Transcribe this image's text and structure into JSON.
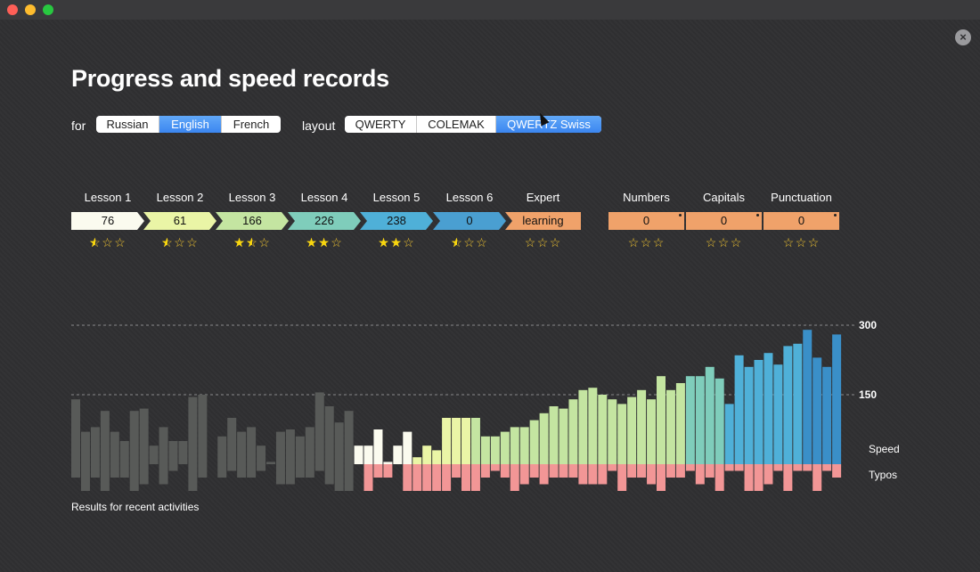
{
  "window": {
    "close_glyph": "×"
  },
  "title": "Progress and speed records",
  "for_label": "for",
  "layout_label": "layout",
  "languages": {
    "options": [
      "Russian",
      "English",
      "French"
    ],
    "selected": "English"
  },
  "layouts": {
    "options": [
      "QWERTY",
      "COLEMAK",
      "QWERTZ Swiss"
    ],
    "selected": "QWERTZ Swiss"
  },
  "lessons": [
    {
      "name": "Lesson 1",
      "value": "76",
      "color": "#fbfbef",
      "stars": 0.5
    },
    {
      "name": "Lesson 2",
      "value": "61",
      "color": "#eaf5a6",
      "stars": 0.5
    },
    {
      "name": "Lesson 3",
      "value": "166",
      "color": "#c4e5a1",
      "stars": 1.5
    },
    {
      "name": "Lesson 4",
      "value": "226",
      "color": "#7fcdbb",
      "stars": 2
    },
    {
      "name": "Lesson 5",
      "value": "238",
      "color": "#4fb0d8",
      "stars": 2
    },
    {
      "name": "Lesson 6",
      "value": "0",
      "color": "#4a9fd1",
      "stars": 0.5
    },
    {
      "name": "Expert",
      "value": "learning",
      "color": "#f0a26a",
      "stars": 0
    }
  ],
  "extras": [
    {
      "name": "Numbers",
      "value": "0",
      "color": "#f0a26a",
      "stars": 0
    },
    {
      "name": "Capitals",
      "value": "0",
      "color": "#f0a26a",
      "stars": 0
    },
    {
      "name": "Punctuation",
      "value": "0",
      "color": "#f0a26a",
      "stars": 0
    }
  ],
  "chart_data": {
    "type": "bar",
    "x": [
      1,
      2,
      3,
      4,
      5,
      6,
      7,
      8,
      9,
      10,
      11,
      12,
      13,
      14,
      15,
      16,
      17,
      18,
      19,
      20,
      21,
      22,
      23,
      24,
      25,
      26,
      27,
      28,
      29,
      30,
      31,
      32,
      33,
      34,
      35,
      36,
      37,
      38,
      39,
      40,
      41,
      42,
      43,
      44,
      45,
      46,
      47,
      48,
      49,
      50,
      51,
      52,
      53,
      54,
      55,
      56,
      57,
      58,
      59,
      60,
      61,
      62,
      63,
      64,
      65,
      66,
      67,
      68,
      69,
      70,
      71,
      72,
      73,
      74,
      75,
      76,
      77,
      78,
      79
    ],
    "series": [
      {
        "name": "Speed",
        "values": [
          140,
          70,
          80,
          115,
          70,
          50,
          115,
          120,
          40,
          80,
          50,
          50,
          145,
          150,
          0,
          60,
          100,
          70,
          80,
          40,
          5,
          70,
          75,
          60,
          80,
          155,
          125,
          90,
          115,
          40,
          40,
          75,
          5,
          40,
          70,
          15,
          40,
          30,
          100,
          100,
          100,
          100,
          60,
          60,
          70,
          80,
          80,
          95,
          110,
          125,
          120,
          140,
          160,
          165,
          150,
          140,
          130,
          145,
          160,
          140,
          190,
          160,
          175,
          190,
          190,
          210,
          185,
          130,
          235,
          210,
          225,
          240,
          215,
          255,
          260,
          290,
          230,
          210,
          280,
          265,
          270,
          270,
          280,
          275,
          240,
          265
        ],
        "colors": [
          "#585a58",
          "#585a58",
          "#585a58",
          "#585a58",
          "#585a58",
          "#585a58",
          "#585a58",
          "#585a58",
          "#585a58",
          "#585a58",
          "#585a58",
          "#585a58",
          "#585a58",
          "#585a58",
          "#585a58",
          "#585a58",
          "#585a58",
          "#585a58",
          "#585a58",
          "#585a58",
          "#585a58",
          "#585a58",
          "#585a58",
          "#585a58",
          "#585a58",
          "#585a58",
          "#585a58",
          "#585a58",
          "#585a58",
          "#fbfbef",
          "#fbfbef",
          "#fbfbef",
          "#fbfbef",
          "#fbfbef",
          "#fbfbef",
          "#eaf5a6",
          "#eaf5a6",
          "#eaf5a6",
          "#eaf5a6",
          "#eaf5a6",
          "#eaf5a6",
          "#c4e5a1",
          "#c4e5a1",
          "#c4e5a1",
          "#c4e5a1",
          "#c4e5a1",
          "#c4e5a1",
          "#c4e5a1",
          "#c4e5a1",
          "#c4e5a1",
          "#c4e5a1",
          "#c4e5a1",
          "#c4e5a1",
          "#c4e5a1",
          "#c4e5a1",
          "#c4e5a1",
          "#c4e5a1",
          "#c4e5a1",
          "#c4e5a1",
          "#c4e5a1",
          "#c4e5a1",
          "#c4e5a1",
          "#c4e5a1",
          "#7fcdbb",
          "#7fcdbb",
          "#7fcdbb",
          "#7fcdbb",
          "#4fb0d8",
          "#4fb0d8",
          "#4fb0d8",
          "#4fb0d8",
          "#4fb0d8",
          "#4fb0d8",
          "#4fb0d8",
          "#4fb0d8",
          "#3a8fc8",
          "#3a8fc8",
          "#3a8fc8",
          "#3a8fc8",
          "#3a8fc8",
          "#3a8fc8",
          "#3a8fc8"
        ]
      },
      {
        "name": "Typos",
        "values": [
          10,
          20,
          10,
          20,
          10,
          10,
          20,
          15,
          0,
          15,
          5,
          0,
          20,
          10,
          0,
          10,
          5,
          10,
          10,
          5,
          0,
          15,
          15,
          10,
          10,
          5,
          15,
          20,
          20,
          0,
          20,
          10,
          10,
          0,
          20,
          20,
          20,
          20,
          20,
          10,
          20,
          20,
          10,
          5,
          10,
          20,
          15,
          10,
          15,
          10,
          10,
          10,
          15,
          15,
          15,
          5,
          20,
          10,
          10,
          15,
          20,
          10,
          10,
          5,
          15,
          10,
          20,
          5,
          5,
          20,
          20,
          15,
          5,
          20,
          5,
          5,
          20,
          5,
          10,
          20,
          5,
          20,
          20,
          10,
          20
        ]
      }
    ],
    "yticks": [
      "300",
      "150"
    ],
    "ylim": [
      0,
      300
    ],
    "dashed_lines": [
      300,
      150
    ],
    "series_labels": [
      "Speed",
      "Typos"
    ],
    "caption": "Results for recent activities"
  }
}
